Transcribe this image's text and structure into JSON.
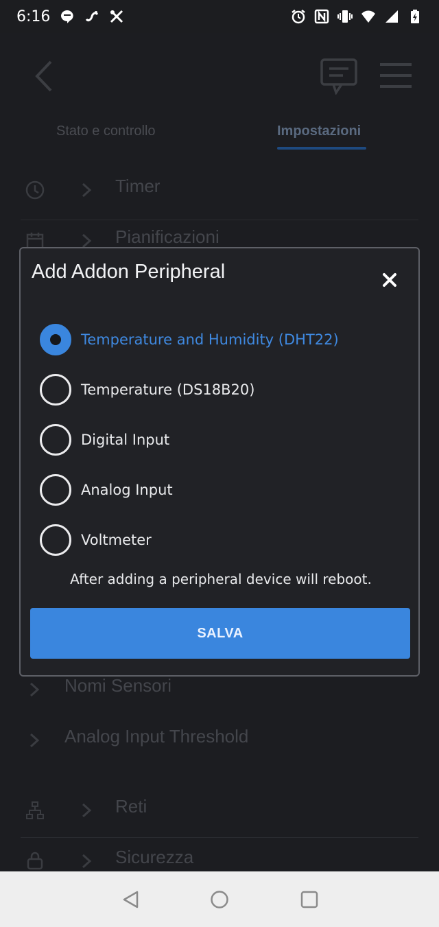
{
  "status_bar": {
    "time": "6:16",
    "left_icons": [
      "message-icon",
      "link-icon",
      "tools-icon"
    ],
    "right_icons": [
      "alarm-icon",
      "nfc-icon",
      "vibrate-icon",
      "wifi-icon",
      "signal-icon",
      "battery-icon"
    ]
  },
  "app": {
    "tabs": [
      {
        "label": "Stato e controllo"
      },
      {
        "label": "Impostazioni"
      }
    ],
    "rows": [
      {
        "label": "Timer",
        "icon": "clock-icon"
      },
      {
        "label": "Pianificazioni",
        "icon": "calendar-icon"
      },
      {
        "label": "Nomi Sensori"
      },
      {
        "label": "Analog Input Threshold"
      },
      {
        "label": "Reti",
        "icon": "network-icon"
      },
      {
        "label": "Sicurezza",
        "icon": "lock-icon"
      }
    ]
  },
  "dialog": {
    "title": "Add Addon Peripheral",
    "options": [
      {
        "label": "Temperature and Humidity (DHT22)",
        "selected": true
      },
      {
        "label": "Temperature (DS18B20)",
        "selected": false
      },
      {
        "label": "Digital Input",
        "selected": false
      },
      {
        "label": "Analog Input",
        "selected": false
      },
      {
        "label": "Voltmeter",
        "selected": false
      }
    ],
    "note": "After adding a peripheral device will reboot.",
    "save_label": "SALVA"
  },
  "colors": {
    "accent": "#3a86de",
    "dialog_bg": "#212226",
    "backdrop": "#131417"
  },
  "nav_bar": {
    "icons": [
      "back-triangle-icon",
      "home-circle-icon",
      "recents-square-icon"
    ]
  }
}
